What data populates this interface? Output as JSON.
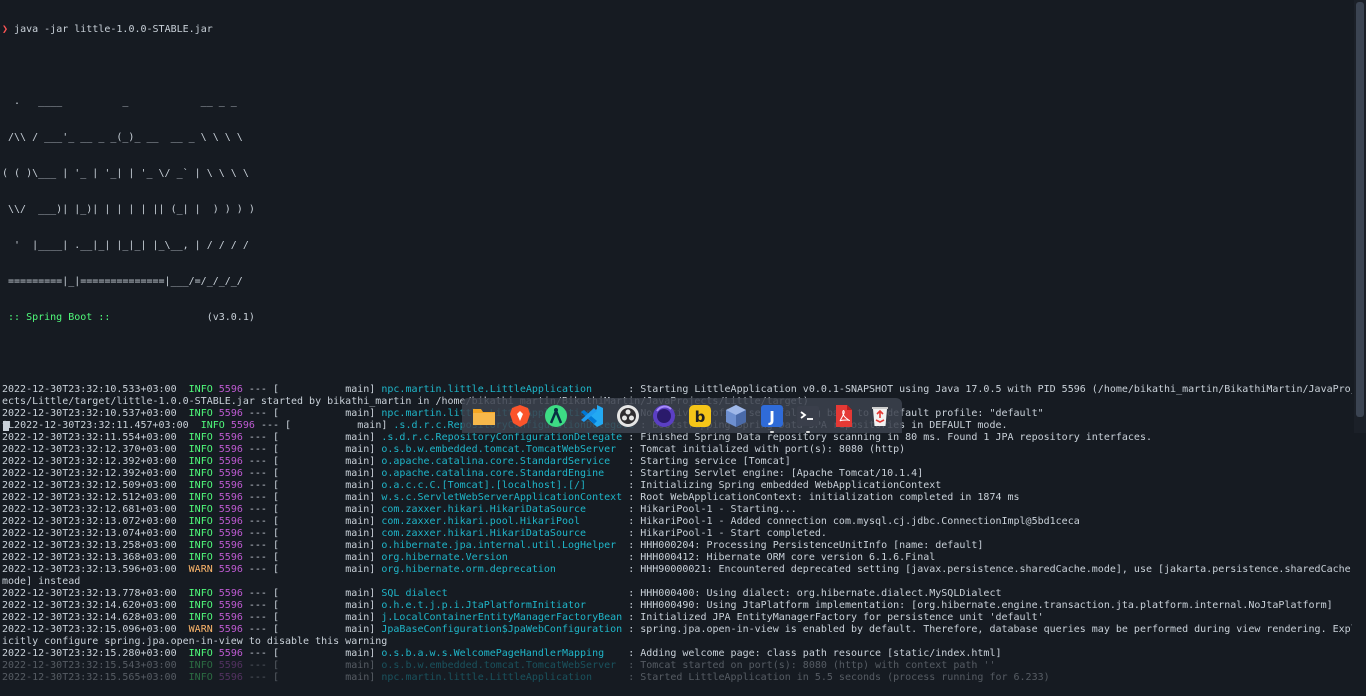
{
  "command": {
    "prompt_symbol": "❯",
    "text": " java -jar little-1.0.0-STABLE.jar"
  },
  "banner": [
    "",
    "  .   ____          _            __ _ _",
    " /\\\\ / ___'_ __ _ _(_)_ __  __ _ \\ \\ \\ \\",
    "( ( )\\___ | '_ | '_| | '_ \\/ _` | \\ \\ \\ \\",
    " \\\\/  ___)| |_)| | | | | || (_| |  ) ) ) )",
    "  '  |____| .__|_| |_|_| |_\\__, | / / / /",
    " =========|_|==============|___/=/_/_/_/"
  ],
  "spring_boot": {
    "label": " :: Spring Boot :: ",
    "version": "               (v3.0.1)"
  },
  "log_lines": [
    {
      "ts": "2022-12-30T23:32:10.533+03:00",
      "level": "INFO",
      "pid": "5596",
      "sep": " --- [           main] ",
      "logger": "npc.martin.little.LittleApplication     ",
      "msg": " : Starting LittleApplication v0.0.1-SNAPSHOT using Java 17.0.5 with PID 5596 (/home/bikathi_martin/BikathiMartin/JavaProj"
    },
    {
      "raw": "ects/Little/target/little-1.0.0-STABLE.jar started by bikathi_martin in /home/bikathi_martin/BikathiMartin/JavaProjects/Little/target)"
    },
    {
      "ts": "2022-12-30T23:32:10.537+03:00",
      "level": "INFO",
      "pid": "5596",
      "sep": " --- [           main] ",
      "logger": "npc.martin.little.LittleApplication     ",
      "msg": " : No active profile set, falling back to 1 default profile: \"default\""
    },
    {
      "prefix": "^L",
      "ts": "2022-12-30T23:32:11.457+03:00",
      "level": "INFO",
      "pid": "5596",
      "sep": " --- [           main] ",
      "logger": ".s.d.r.c.RepositoryConfigurationDelegate",
      "msg": " : Bootstrapping Spring Data JPA repositories in DEFAULT mode."
    },
    {
      "ts": "2022-12-30T23:32:11.554+03:00",
      "level": "INFO",
      "pid": "5596",
      "sep": " --- [           main] ",
      "logger": ".s.d.r.c.RepositoryConfigurationDelegate",
      "msg": " : Finished Spring Data repository scanning in 80 ms. Found 1 JPA repository interfaces."
    },
    {
      "ts": "2022-12-30T23:32:12.370+03:00",
      "level": "INFO",
      "pid": "5596",
      "sep": " --- [           main] ",
      "logger": "o.s.b.w.embedded.tomcat.TomcatWebServer ",
      "msg": " : Tomcat initialized with port(s): 8080 (http)"
    },
    {
      "ts": "2022-12-30T23:32:12.392+03:00",
      "level": "INFO",
      "pid": "5596",
      "sep": " --- [           main] ",
      "logger": "o.apache.catalina.core.StandardService  ",
      "msg": " : Starting service [Tomcat]"
    },
    {
      "ts": "2022-12-30T23:32:12.392+03:00",
      "level": "INFO",
      "pid": "5596",
      "sep": " --- [           main] ",
      "logger": "o.apache.catalina.core.StandardEngine   ",
      "msg": " : Starting Servlet engine: [Apache Tomcat/10.1.4]"
    },
    {
      "ts": "2022-12-30T23:32:12.509+03:00",
      "level": "INFO",
      "pid": "5596",
      "sep": " --- [           main] ",
      "logger": "o.a.c.c.C.[Tomcat].[localhost].[/]      ",
      "msg": " : Initializing Spring embedded WebApplicationContext"
    },
    {
      "ts": "2022-12-30T23:32:12.512+03:00",
      "level": "INFO",
      "pid": "5596",
      "sep": " --- [           main] ",
      "logger": "w.s.c.ServletWebServerApplicationContext",
      "msg": " : Root WebApplicationContext: initialization completed in 1874 ms"
    },
    {
      "ts": "2022-12-30T23:32:12.681+03:00",
      "level": "INFO",
      "pid": "5596",
      "sep": " --- [           main] ",
      "logger": "com.zaxxer.hikari.HikariDataSource      ",
      "msg": " : HikariPool-1 - Starting..."
    },
    {
      "ts": "2022-12-30T23:32:13.072+03:00",
      "level": "INFO",
      "pid": "5596",
      "sep": " --- [           main] ",
      "logger": "com.zaxxer.hikari.pool.HikariPool       ",
      "msg": " : HikariPool-1 - Added connection com.mysql.cj.jdbc.ConnectionImpl@5bd1ceca"
    },
    {
      "ts": "2022-12-30T23:32:13.074+03:00",
      "level": "INFO",
      "pid": "5596",
      "sep": " --- [           main] ",
      "logger": "com.zaxxer.hikari.HikariDataSource      ",
      "msg": " : HikariPool-1 - Start completed."
    },
    {
      "ts": "2022-12-30T23:32:13.258+03:00",
      "level": "INFO",
      "pid": "5596",
      "sep": " --- [           main] ",
      "logger": "o.hibernate.jpa.internal.util.LogHelper ",
      "msg": " : HHH000204: Processing PersistenceUnitInfo [name: default]"
    },
    {
      "ts": "2022-12-30T23:32:13.368+03:00",
      "level": "INFO",
      "pid": "5596",
      "sep": " --- [           main] ",
      "logger": "org.hibernate.Version                   ",
      "msg": " : HHH000412: Hibernate ORM core version 6.1.6.Final"
    },
    {
      "ts": "2022-12-30T23:32:13.596+03:00",
      "level": "WARN",
      "pid": "5596",
      "sep": " --- [           main] ",
      "logger": "org.hibernate.orm.deprecation           ",
      "msg": " : HHH90000021: Encountered deprecated setting [javax.persistence.sharedCache.mode], use [jakarta.persistence.sharedCache."
    },
    {
      "raw": "mode] instead"
    },
    {
      "ts": "2022-12-30T23:32:13.778+03:00",
      "level": "INFO",
      "pid": "5596",
      "sep": " --- [           main] ",
      "logger": "SQL dialect                             ",
      "msg": " : HHH000400: Using dialect: org.hibernate.dialect.MySQLDialect"
    },
    {
      "ts": "2022-12-30T23:32:14.620+03:00",
      "level": "INFO",
      "pid": "5596",
      "sep": " --- [           main] ",
      "logger": "o.h.e.t.j.p.i.JtaPlatformInitiator      ",
      "msg": " : HHH000490: Using JtaPlatform implementation: [org.hibernate.engine.transaction.jta.platform.internal.NoJtaPlatform]"
    },
    {
      "ts": "2022-12-30T23:32:14.628+03:00",
      "level": "INFO",
      "pid": "5596",
      "sep": " --- [           main] ",
      "logger": "j.LocalContainerEntityManagerFactoryBean",
      "msg": " : Initialized JPA EntityManagerFactory for persistence unit 'default'"
    },
    {
      "ts": "2022-12-30T23:32:15.096+03:00",
      "level": "WARN",
      "pid": "5596",
      "sep": " --- [           main] ",
      "logger": "JpaBaseConfiguration$JpaWebConfiguration",
      "msg": " : spring.jpa.open-in-view is enabled by default. Therefore, database queries may be performed during view rendering. Expl"
    },
    {
      "raw": "icitly configure spring.jpa.open-in-view to disable this warning"
    },
    {
      "ts": "2022-12-30T23:32:15.280+03:00",
      "level": "INFO",
      "pid": "5596",
      "sep": " --- [           main] ",
      "logger": "o.s.b.a.w.s.WelcomePageHandlerMapping   ",
      "msg": " : Adding welcome page: class path resource [static/index.html]"
    },
    {
      "ts": "2022-12-30T23:32:15.543+03:00",
      "level": "INFO",
      "pid": "5596",
      "sep": " --- [           main] ",
      "logger": "o.s.b.w.embedded.tomcat.TomcatWebServer ",
      "msg": " : Tomcat started on port(s): 8080 (http) with context path ''",
      "faded": true
    },
    {
      "ts": "2022-12-30T23:32:15.565+03:00",
      "level": "INFO",
      "pid": "5596",
      "sep": " --- [           main] ",
      "logger": "npc.martin.little.LittleApplication     ",
      "msg": " : Started LittleApplication in 5.5 seconds (process running for 6.233)",
      "faded": true
    }
  ],
  "colors": {
    "background": "#161b22",
    "info": "#50fa7b",
    "warn": "#ffb86c",
    "pid": "#bd5ad1",
    "logger": "#1fb6c9",
    "prompt": "#ff5555"
  },
  "dock": [
    {
      "name": "files-icon"
    },
    {
      "name": "brave-icon"
    },
    {
      "name": "android-studio-icon"
    },
    {
      "name": "vscode-icon"
    },
    {
      "name": "obs-icon"
    },
    {
      "name": "firefox-icon"
    },
    {
      "name": "bitwarden-icon"
    },
    {
      "name": "virtualbox-icon"
    },
    {
      "name": "jetbrains-icon"
    },
    {
      "name": "terminal-icon"
    },
    {
      "name": "pdf-icon"
    },
    {
      "name": "trash-icon"
    }
  ]
}
